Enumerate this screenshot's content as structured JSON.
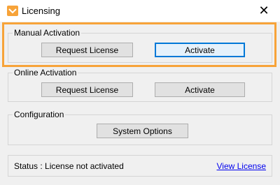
{
  "window": {
    "title": "Licensing",
    "close_glyph": "✕",
    "icon": "app-icon",
    "accent_color": "#f7a339"
  },
  "manual": {
    "label": "Manual Activation",
    "request_label": "Request License",
    "activate_label": "Activate"
  },
  "online": {
    "label": "Online Activation",
    "request_label": "Request License",
    "activate_label": "Activate"
  },
  "configuration": {
    "label": "Configuration",
    "system_options_label": "System Options"
  },
  "status": {
    "text": "Status : License not activated",
    "link_label": "View License"
  }
}
